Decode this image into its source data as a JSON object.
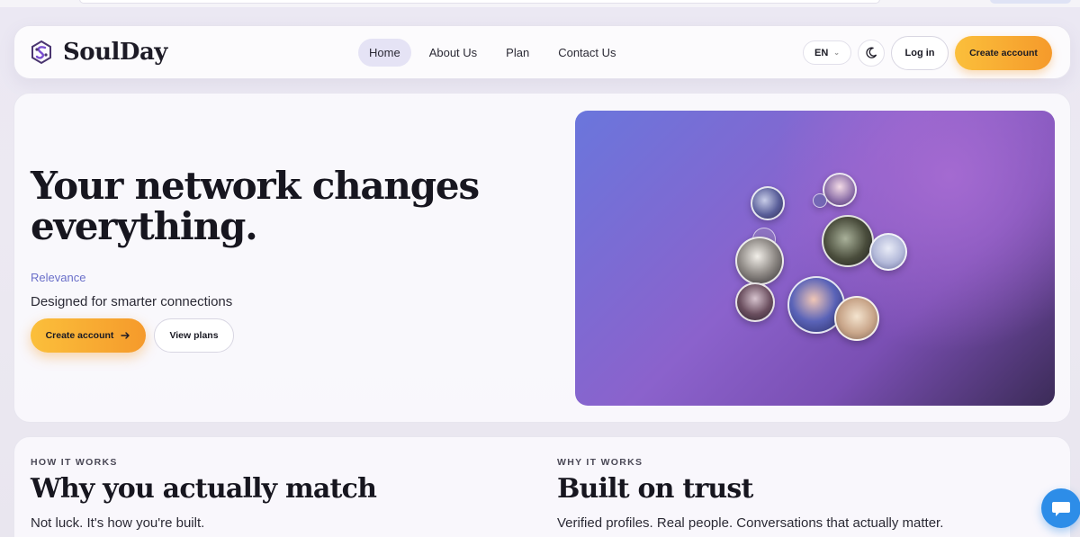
{
  "app": {
    "brand": "SoulDay"
  },
  "nav": {
    "links": [
      {
        "label": "Home",
        "active": true
      },
      {
        "label": "About Us",
        "active": false
      },
      {
        "label": "Plan",
        "active": false
      },
      {
        "label": "Contact Us",
        "active": false
      }
    ],
    "language": "EN",
    "login_label": "Log in",
    "create_label": "Create account"
  },
  "hero": {
    "title": "Your network changes everything.",
    "tag": "Relevance",
    "subtitle": "Designed for smarter connections",
    "create_label": "Create account",
    "plans_label": "View plans"
  },
  "sections": {
    "how": {
      "eyebrow": "HOW IT WORKS",
      "title": "Why you actually match",
      "subtitle": "Not luck. It's how you're built."
    },
    "why": {
      "eyebrow": "WHY IT WORKS",
      "title": "Built on trust",
      "subtitle": "Verified profiles. Real people. Conversations that actually matter."
    }
  },
  "colors": {
    "accent": "#f59a2b",
    "accent_light": "#fbbf3b",
    "link": "#6a6fc9",
    "nav_active": "#e5e3f5",
    "chat": "#2d8de8"
  },
  "icons": {
    "brand": "soulday-logo-icon",
    "theme": "moon-icon",
    "lang": "chevron-down-icon",
    "arrow": "arrow-right-icon",
    "chat": "chat-bubble-icon"
  }
}
